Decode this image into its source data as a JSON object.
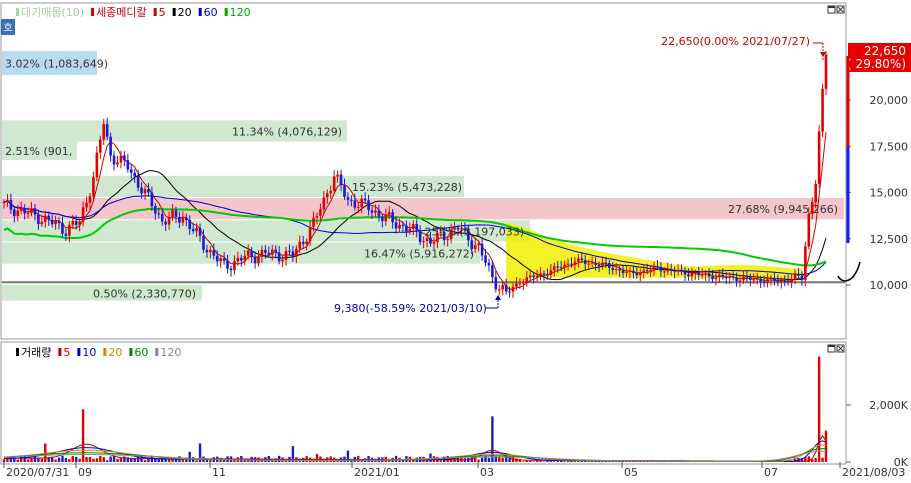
{
  "header": {
    "price_legend": [
      {
        "label": "대기매물(10)",
        "color": "#9fd79f"
      },
      {
        "label": "세종메디칼",
        "color": "#cc0000"
      },
      {
        "label": "5",
        "color": "#cc0000"
      },
      {
        "label": "20",
        "color": "#000000"
      },
      {
        "label": "60",
        "color": "#0000cc"
      },
      {
        "label": "120",
        "color": "#00aa00"
      }
    ],
    "volume_legend": [
      {
        "label": "거래량",
        "color": "#000000"
      },
      {
        "label": "5",
        "color": "#cc0000"
      },
      {
        "label": "10",
        "color": "#0000cc"
      },
      {
        "label": "20",
        "color": "#cc8800"
      },
      {
        "label": "60",
        "color": "#008800"
      },
      {
        "label": "120",
        "color": "#888888"
      }
    ],
    "side_button": "호"
  },
  "chart_data": [
    {
      "type": "candlestick",
      "title": "세종메디칼",
      "ylim": [
        8000,
        23000
      ],
      "y_ticks": [
        "10,000",
        "12,500",
        "15,000",
        "17,500",
        "20,000"
      ],
      "x_ticks": [
        "2020/07/31",
        "09",
        "11",
        "2021/01",
        "03",
        "05",
        "07",
        "2021/08/03"
      ],
      "moving_averages": [
        "5",
        "20",
        "60",
        "120"
      ],
      "volume_profile_bands": [
        {
          "label": "3.02% (1,083,649)",
          "price_low": 21300,
          "price_high": 22650
        },
        {
          "label": "11.34% (4,076,129)",
          "price_low": 17700,
          "price_high": 18900
        },
        {
          "label": "2.51% (901,",
          "price_low": 16700,
          "price_high": 17800
        },
        {
          "label": "15.23% (5,473,228)",
          "price_low": 14700,
          "price_high": 15900
        },
        {
          "label": "27.68% (9,945,266)",
          "price_low": 13500,
          "price_high": 14700
        },
        {
          "label": "255% (5,197,033)",
          "price_low": 12300,
          "price_high": 13500
        },
        {
          "label": "16.47% (5,916,272)",
          "price_low": 11100,
          "price_high": 12300
        },
        {
          "label": "0.50% (2,330,770)",
          "price_low": 9100,
          "price_high": 10000
        }
      ],
      "annotations": {
        "high": "22,650(0.00% 2021/07/27)",
        "low": "9,380(-58.59% 2021/03/10)",
        "current_price": "22,650",
        "current_change": "( 29.80%)"
      },
      "reference_line": 10150
    },
    {
      "type": "bar",
      "title": "거래량",
      "y_ticks": [
        "0K",
        "2,000K"
      ],
      "ylim": [
        0,
        4000
      ]
    }
  ]
}
